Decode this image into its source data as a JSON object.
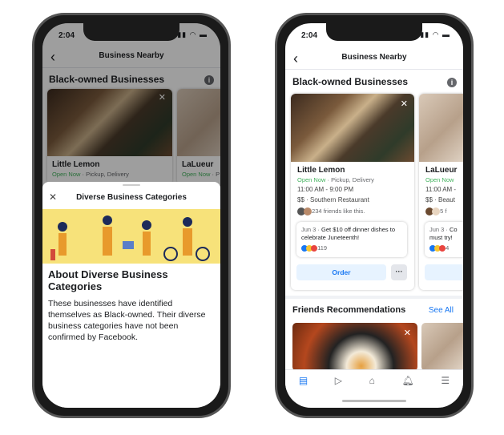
{
  "left_phone": {
    "status_time": "2:04",
    "header_title": "Business Nearby",
    "section_title": "Black-owned Businesses",
    "cards": [
      {
        "name": "Little Lemon",
        "open": "Open Now",
        "details": " · Pickup, Delivery"
      },
      {
        "name": "LaLueur",
        "open": "Open Now",
        "details": " · P"
      }
    ],
    "sheet": {
      "title": "Diverse Business Categories",
      "heading": "About Diverse Business Categories",
      "body": "These businesses have identified themselves as Black-owned. Their diverse business categories have not been confirmed by Facebook."
    }
  },
  "right_phone": {
    "status_time": "2:04",
    "header_title": "Business Nearby",
    "section_title": "Black-owned Businesses",
    "cards": [
      {
        "name": "Little Lemon",
        "open": "Open Now",
        "details": " · Pickup, Delivery",
        "hours": "11:00 AM - 9:00 PM",
        "category": "$$ · Southern Restaurant",
        "friends": "234 friends like this.",
        "post_date": "Jun 3 · ",
        "post_text": "Get $10 off dinner dishes to celebrate Juneteenth!",
        "reactions": "119",
        "order_label": "Order",
        "more_label": "···"
      },
      {
        "name": "LaLueur",
        "open": "Open Now",
        "hours": "11:00 AM -",
        "category": "$$ · Beaut",
        "friends": "5 f",
        "post_date": "Jun 3 · ",
        "post_text": "Co must try!",
        "reactions": "4",
        "order_label": ""
      }
    ],
    "recommendations": {
      "title": "Friends Recommendations",
      "see_all": "See All"
    },
    "tabs": [
      "news-feed",
      "watch",
      "marketplace",
      "notifications",
      "menu"
    ]
  },
  "colors": {
    "accent": "#1877f2",
    "open_green": "#44b35f",
    "illustration_yellow": "#f7e27a"
  }
}
